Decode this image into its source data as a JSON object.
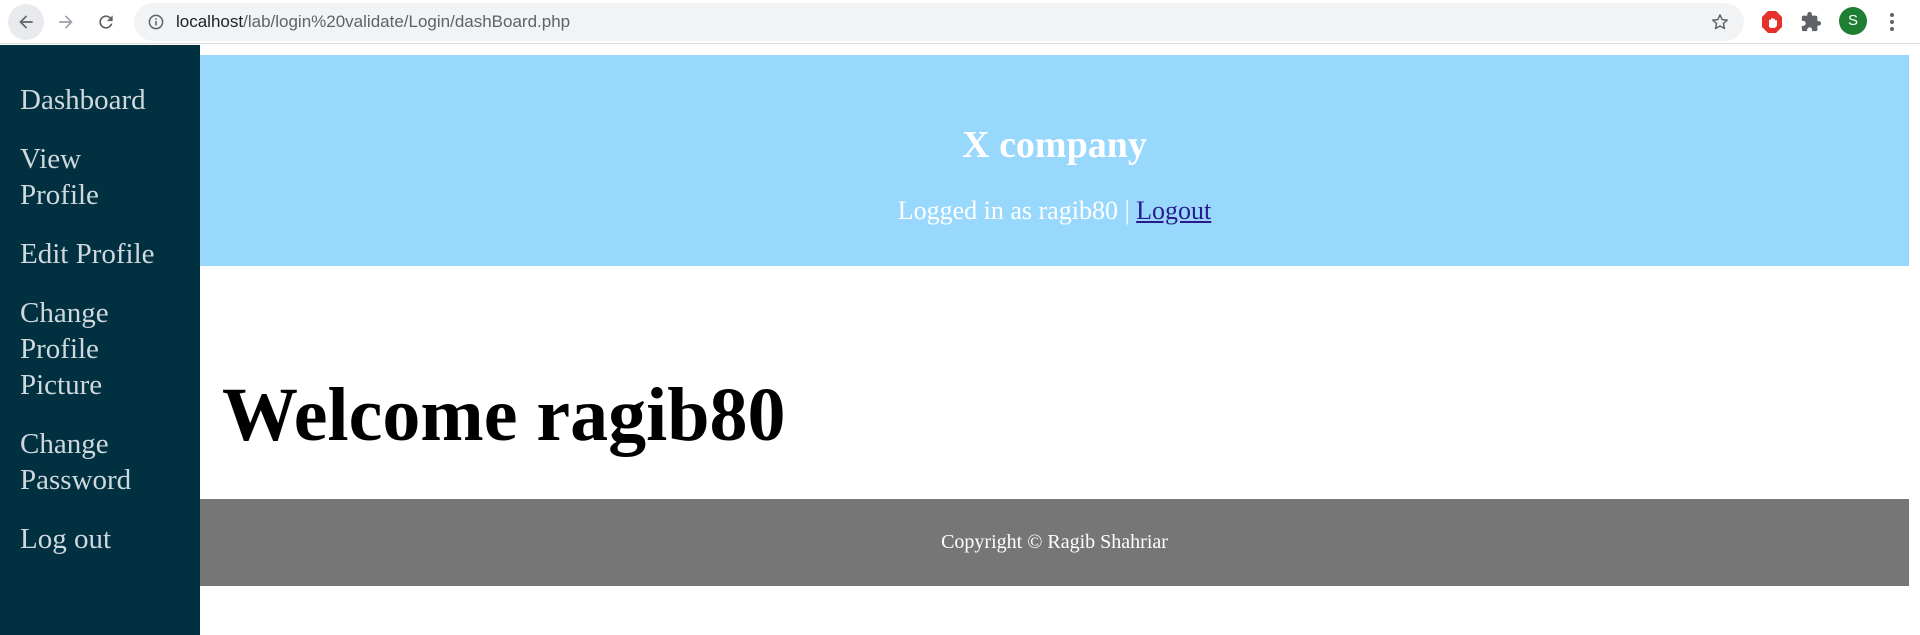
{
  "browser": {
    "url_host": "localhost",
    "url_path": "/lab/login%20validate/Login/dashBoard.php",
    "profile_initial": "S",
    "icons": {
      "back": "arrow-left-icon",
      "forward": "arrow-right-icon",
      "reload": "reload-icon",
      "info": "info-icon",
      "bookmark": "star-icon",
      "adblock": "adblock-icon",
      "extensions": "puzzle-icon",
      "menu": "three-dots-icon"
    }
  },
  "sidebar": {
    "items": [
      {
        "label": "Dashboard"
      },
      {
        "label": "View Profile"
      },
      {
        "label": "Edit Profile"
      },
      {
        "label": "Change Profile Picture"
      },
      {
        "label": "Change Password"
      },
      {
        "label": "Log out"
      }
    ]
  },
  "header": {
    "company": "X company",
    "logged_in_text": "Logged in as ragib80 | ",
    "logout_label": "Logout"
  },
  "main": {
    "welcome": "Welcome ragib80"
  },
  "footer": {
    "copyright": "Copyright © Ragib Shahriar"
  },
  "colors": {
    "sidebar_bg": "#013040",
    "header_bg": "#99d8fd",
    "footer_bg": "#767676",
    "logout_link": "#2a1a8a"
  }
}
